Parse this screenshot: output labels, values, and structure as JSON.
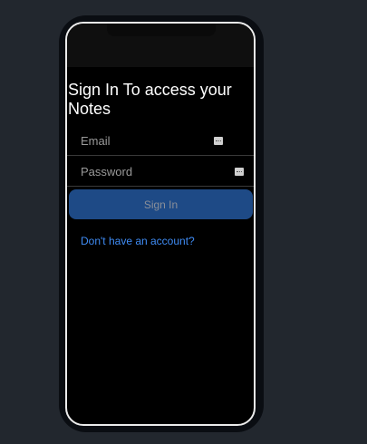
{
  "page": {
    "background": "#22272e"
  },
  "login": {
    "title": "Sign In To access your Notes",
    "email_placeholder": "Email",
    "password_placeholder": "Password",
    "signin_label": "Sign In",
    "signup_link": "Don't have an account?"
  },
  "icons": {
    "email_field_icon": "autofill-key-icon",
    "password_field_icon": "autofill-key-icon"
  },
  "colors": {
    "button": "#1e4a86",
    "link": "#3f8cf5",
    "screen": "#000000"
  }
}
